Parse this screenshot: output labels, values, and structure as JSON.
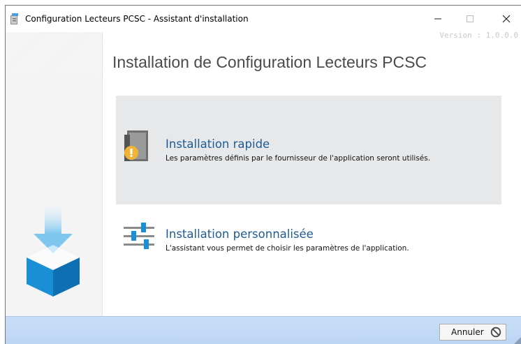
{
  "window": {
    "title": "Configuration Lecteurs PCSC - Assistant d'installation",
    "version": "Version : 1.0.0.0",
    "controls": {
      "minimize": "—",
      "maximize": "☐",
      "close": "✕"
    }
  },
  "main": {
    "title": "Installation de Configuration Lecteurs PCSC",
    "options": [
      {
        "title": "Installation rapide",
        "description": "Les paramètres définis par le fournisseur de l'application seront utilisés.",
        "icon": "quick-install-icon",
        "highlighted": true
      },
      {
        "title": "Installation personnalisée",
        "description": "L'assistant vous permet de choisir les paramètres de l'application.",
        "icon": "sliders-icon",
        "highlighted": false
      }
    ]
  },
  "footer": {
    "cancel_label": "Annuler",
    "cancel_icon": "prohibited-icon"
  },
  "colors": {
    "accent": "#1e5b93",
    "footer": "#c4d9f5",
    "selected_option": "#e7e8ea",
    "art_blue": "#1a8fd6"
  }
}
